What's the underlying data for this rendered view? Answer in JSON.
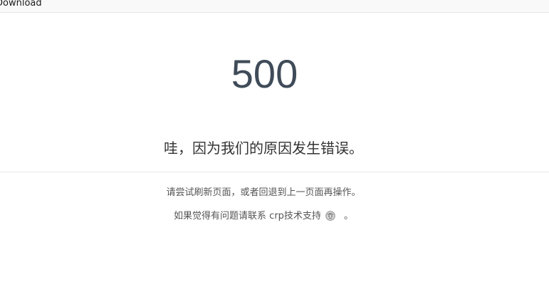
{
  "topbar": {
    "link_text": "Download"
  },
  "error": {
    "code": "500",
    "headline": "哇，因为我们的原因发生错误。",
    "hint": "请尝试刷新页面，或者回退到上一页面再操作。",
    "contact_text": "如果觉得有问题请联系 crp技术支持",
    "contact_icon": "support-face-icon",
    "contact_end": "。"
  },
  "colors": {
    "code": "#3f4b58",
    "text": "#555555",
    "divider": "#e8e8e8"
  }
}
